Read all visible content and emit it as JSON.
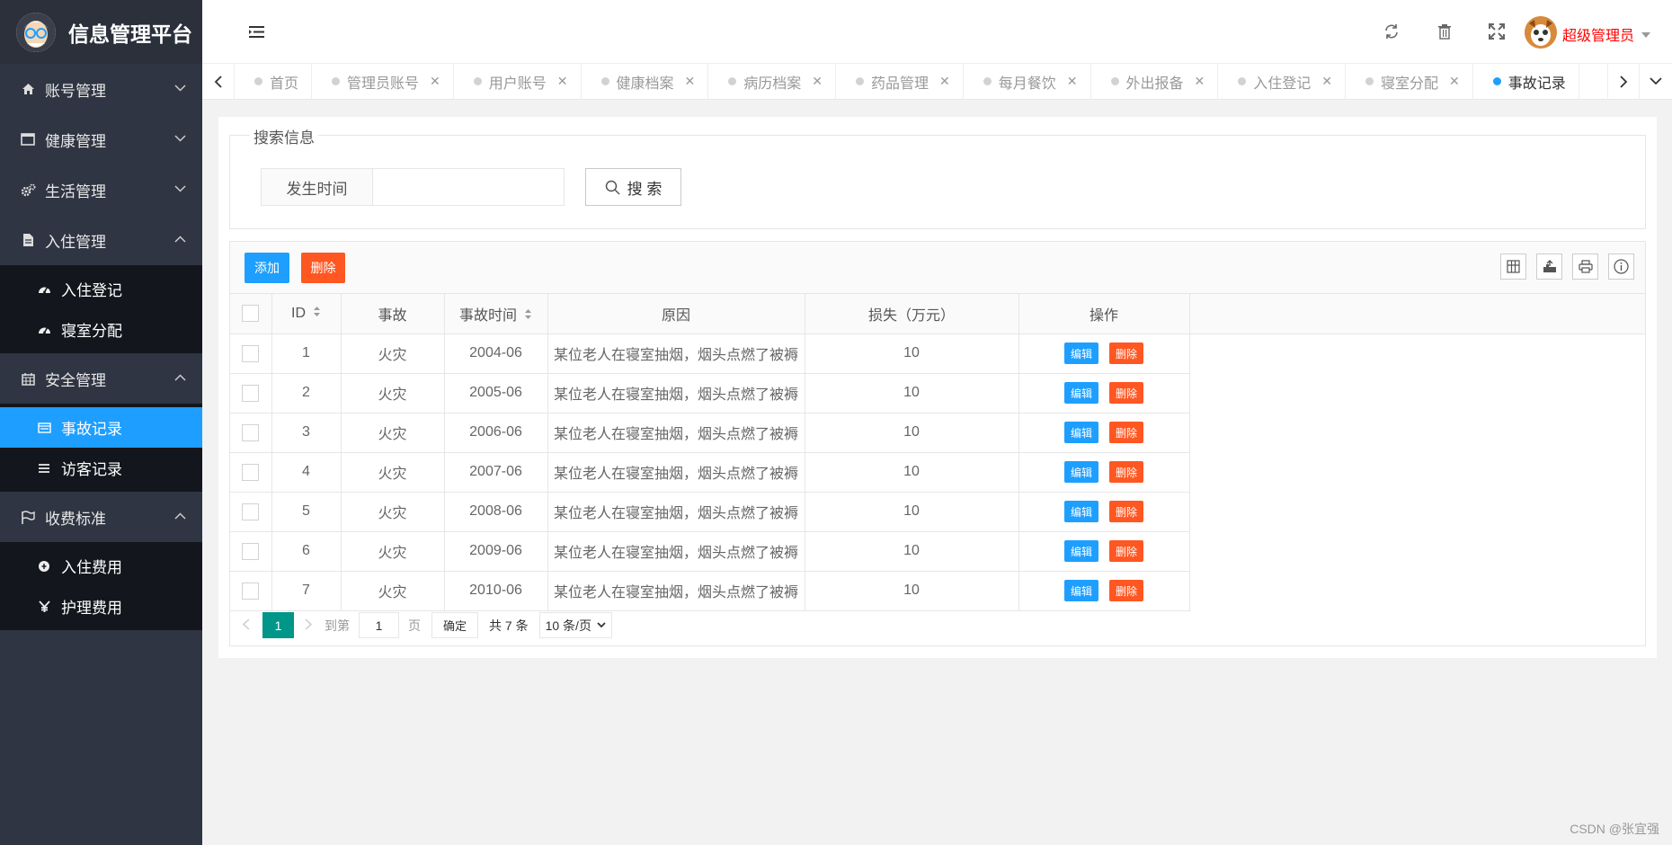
{
  "app": {
    "title": "信息管理平台"
  },
  "sidebar": {
    "groups": [
      {
        "label": "账号管理",
        "icon": "home-icon",
        "expanded": false
      },
      {
        "label": "健康管理",
        "icon": "window-icon",
        "expanded": false
      },
      {
        "label": "生活管理",
        "icon": "gears-icon",
        "expanded": false
      },
      {
        "label": "入住管理",
        "icon": "document-icon",
        "expanded": true,
        "items": [
          {
            "label": "入住登记",
            "icon": "dashboard-icon"
          },
          {
            "label": "寝室分配",
            "icon": "dashboard-icon"
          }
        ]
      },
      {
        "label": "安全管理",
        "icon": "calendar-icon",
        "expanded": true,
        "items": [
          {
            "label": "事故记录",
            "icon": "list-icon",
            "active": true
          },
          {
            "label": "访客记录",
            "icon": "bars-icon"
          }
        ]
      },
      {
        "label": "收费标准",
        "icon": "flag-icon",
        "expanded": true,
        "items": [
          {
            "label": "入住费用",
            "icon": "coin-icon"
          },
          {
            "label": "护理费用",
            "icon": "yen-icon"
          }
        ]
      }
    ]
  },
  "header": {
    "user": "超级管理员"
  },
  "tabs": [
    {
      "label": "首页",
      "closable": false
    },
    {
      "label": "管理员账号",
      "closable": true
    },
    {
      "label": "用户账号",
      "closable": true
    },
    {
      "label": "健康档案",
      "closable": true
    },
    {
      "label": "病历档案",
      "closable": true
    },
    {
      "label": "药品管理",
      "closable": true
    },
    {
      "label": "每月餐饮",
      "closable": true
    },
    {
      "label": "外出报备",
      "closable": true
    },
    {
      "label": "入住登记",
      "closable": true
    },
    {
      "label": "寝室分配",
      "closable": true
    },
    {
      "label": "事故记录",
      "closable": false,
      "active": true
    }
  ],
  "search": {
    "legend": "搜索信息",
    "field_label": "发生时间",
    "field_value": "",
    "button": "搜 索"
  },
  "toolbar": {
    "add": "添加",
    "delete": "删除"
  },
  "table": {
    "columns": [
      "ID",
      "事故",
      "事故时间",
      "原因",
      "损失（万元）",
      "操作"
    ],
    "rows": [
      {
        "id": "1",
        "type": "火灾",
        "time": "2004-06",
        "reason": "某位老人在寝室抽烟，烟头点燃了被褥",
        "loss": "10"
      },
      {
        "id": "2",
        "type": "火灾",
        "time": "2005-06",
        "reason": "某位老人在寝室抽烟，烟头点燃了被褥",
        "loss": "10"
      },
      {
        "id": "3",
        "type": "火灾",
        "time": "2006-06",
        "reason": "某位老人在寝室抽烟，烟头点燃了被褥",
        "loss": "10"
      },
      {
        "id": "4",
        "type": "火灾",
        "time": "2007-06",
        "reason": "某位老人在寝室抽烟，烟头点燃了被褥",
        "loss": "10"
      },
      {
        "id": "5",
        "type": "火灾",
        "time": "2008-06",
        "reason": "某位老人在寝室抽烟，烟头点燃了被褥",
        "loss": "10"
      },
      {
        "id": "6",
        "type": "火灾",
        "time": "2009-06",
        "reason": "某位老人在寝室抽烟，烟头点燃了被褥",
        "loss": "10"
      },
      {
        "id": "7",
        "type": "火灾",
        "time": "2010-06",
        "reason": "某位老人在寝室抽烟，烟头点燃了被褥",
        "loss": "10"
      }
    ],
    "edit_label": "编辑",
    "delete_label": "删除"
  },
  "pager": {
    "current": "1",
    "goto_prefix": "到第",
    "goto_value": "1",
    "goto_suffix": "页",
    "ok": "确定",
    "total": "共 7 条",
    "page_size": "10 条/页"
  },
  "watermark": "CSDN @张宜强"
}
